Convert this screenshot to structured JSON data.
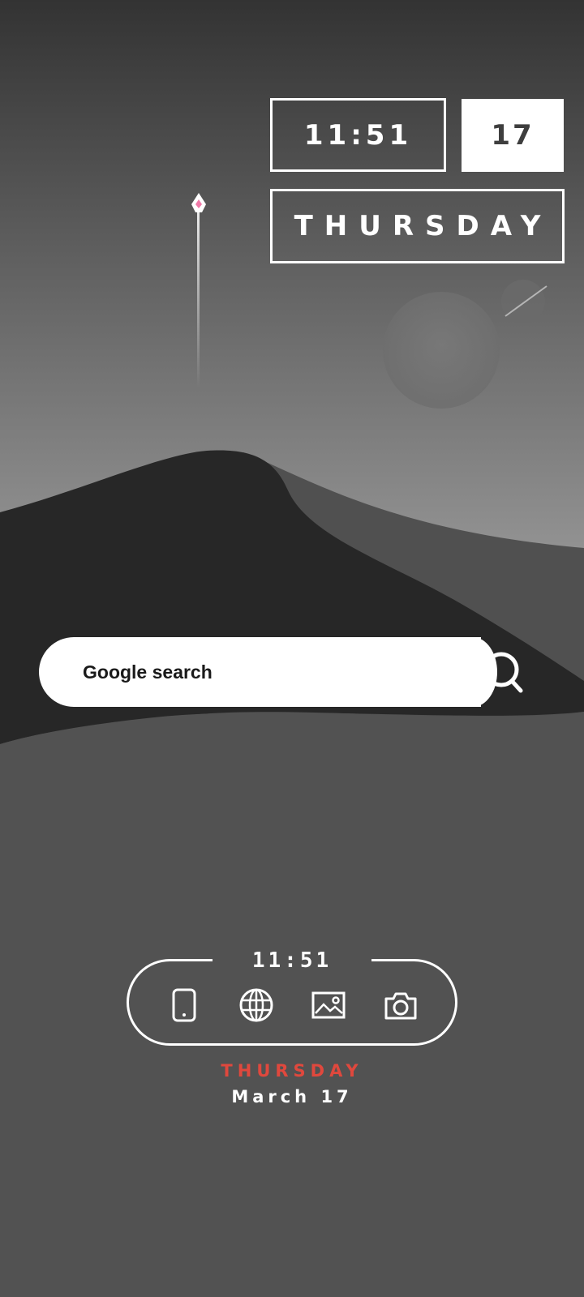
{
  "wallpaper": {
    "sky_top": "#333333",
    "sky_bottom": "#8e8e8e",
    "dune_dark": "#272727",
    "dune_mid": "#4f4f4f",
    "ground": "#525252",
    "rocket_accent": "#f07aa8"
  },
  "clock_widget": {
    "time": "11:51",
    "date_number": "17",
    "day": "THURSDAY"
  },
  "search": {
    "label": "Google search",
    "icon": "search-icon"
  },
  "dock": {
    "clock": "11:51",
    "apps": [
      {
        "name": "phone",
        "icon": "phone-icon"
      },
      {
        "name": "browser",
        "icon": "globe-icon"
      },
      {
        "name": "gallery",
        "icon": "image-icon"
      },
      {
        "name": "camera",
        "icon": "camera-icon"
      }
    ],
    "day": "THURSDAY",
    "date": "March 17",
    "accent": "#e0483d"
  }
}
